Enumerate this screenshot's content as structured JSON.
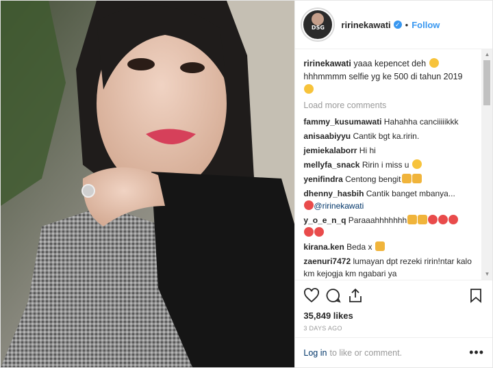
{
  "header": {
    "username": "ririnekawati",
    "verified_mark": "✓",
    "separator": "•",
    "follow_label": "Follow",
    "avatar_text": "DSG"
  },
  "caption": {
    "username": "ririnekawati",
    "text": "yaaa kepencet deh",
    "line2": "hhhmmmm selfie yg ke 500 di tahun 2019"
  },
  "load_more": "Load more comments",
  "comments": [
    {
      "user": "fammy_kusumawati",
      "text": "Hahahha canciiiiikkk"
    },
    {
      "user": "anisaabiyyu",
      "text": "Cantik bgt ka.ririn."
    },
    {
      "user": "jemiekalaborr",
      "text": "Hi hi"
    },
    {
      "user": "mellyfa_snack",
      "text": "Ririn i miss u"
    },
    {
      "user": "yenifindra",
      "text": "Centong bengit"
    },
    {
      "user": "dhenny_hasbih",
      "text": "Cantik banget mbanya...",
      "mention": "@ririnekawati"
    },
    {
      "user": "y_o_e_n_q",
      "text": "Paraaahhhhhhh"
    },
    {
      "user": "kirana.ken",
      "text": "Beda x"
    },
    {
      "user": "zaenuri7472",
      "text": "lumayan dpt rezeki ririn!ntar kalo km kejogja km ngabari ya"
    }
  ],
  "likes": "35,849 likes",
  "timestamp": "3 DAYS AGO",
  "login": {
    "link": "Log in",
    "text": "to like or comment.",
    "more": "•••"
  },
  "icons": [
    "heart-icon",
    "comment-icon",
    "share-icon",
    "bookmark-icon"
  ],
  "colors": {
    "accent": "#3897f0",
    "mention": "#003569"
  }
}
